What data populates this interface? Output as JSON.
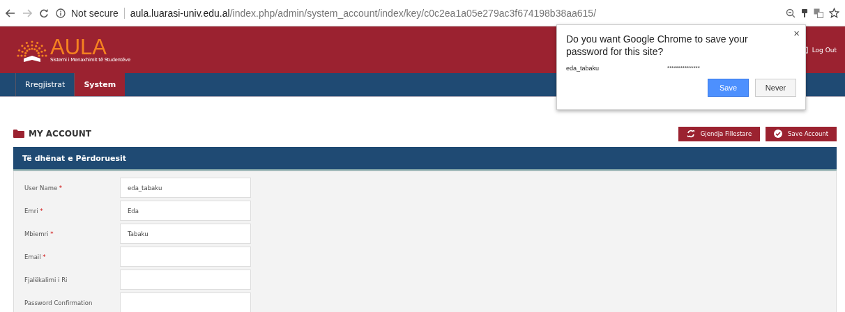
{
  "browser": {
    "security": "Not secure",
    "url_host": "aula.luarasi-univ.edu.al",
    "url_path": "/index.php/admin/system_account/index/key/c0c2ea1a05e279ac3f674198b38aa615/"
  },
  "header": {
    "logo": "AULA",
    "tagline": "Sistemi i Menaxhimit të Studentëve",
    "logout": "Log Out"
  },
  "tabs": [
    {
      "label": "Rregjistrat",
      "selected": false
    },
    {
      "label": "System",
      "selected": true
    }
  ],
  "page_title": "MY ACCOUNT",
  "actions": [
    {
      "kind": "reset",
      "label": "Gjendja Fillestare"
    },
    {
      "kind": "save",
      "label": "Save Account"
    }
  ],
  "panel": {
    "title": "Të dhënat e Përdoruesit",
    "fields": [
      {
        "label": "User Name",
        "required_mark": "*",
        "value": "eda_tabaku"
      },
      {
        "label": "Emri",
        "required_mark": "*",
        "value": "Eda"
      },
      {
        "label": "Mbiemri",
        "required_mark": "*",
        "value": "Tabaku"
      },
      {
        "label": "Email",
        "required_mark": "*"
      },
      {
        "label": "Fjalëkalimi i Ri"
      },
      {
        "label": "Password Confirmation"
      }
    ]
  },
  "popup": {
    "question": "Do you want Google Chrome to save your password for this site?",
    "username": "eda_tabaku",
    "password": "***************",
    "buttons": [
      "Save",
      "Never"
    ],
    "close": "×"
  }
}
